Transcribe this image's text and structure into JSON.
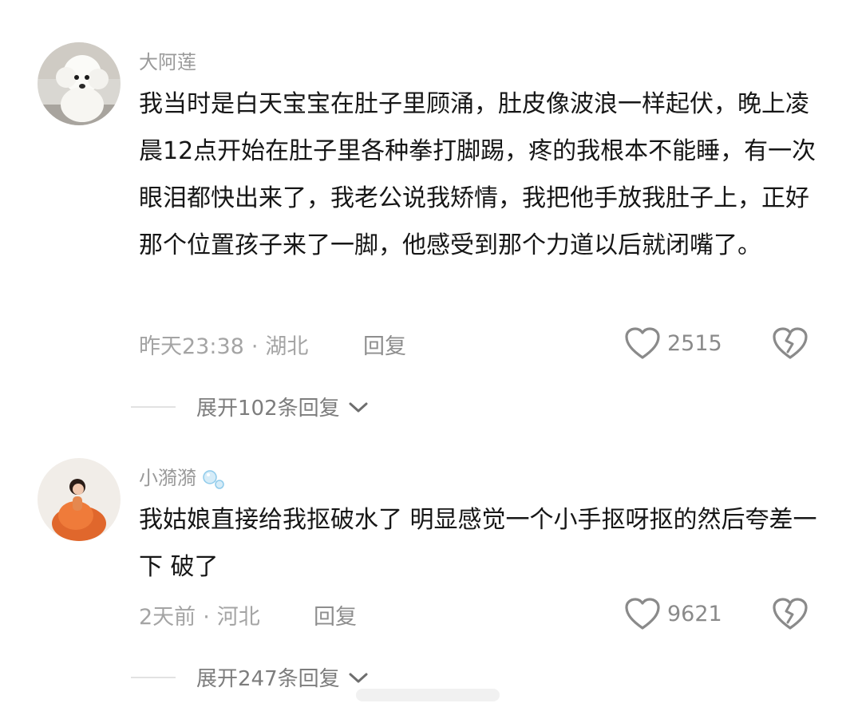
{
  "comments": [
    {
      "username": "大阿莲",
      "text": "我当时是白天宝宝在肚子里顾涌，肚皮像波浪一样起伏，晚上凌晨12点开始在肚子里各种拳打脚踢，疼的我根本不能睡，有一次眼泪都快出来了，我老公说我矫情，我把他手放我肚子上，正好那个位置孩子来了一脚，他感受到那个力道以后就闭嘴了。",
      "time": "昨天23:38",
      "separator": "·",
      "location": "湖北",
      "reply_label": "回复",
      "likes": "2515",
      "expand_label": "展开102条回复",
      "avatar_icon": "white-poodle-avatar"
    },
    {
      "username": "小漪漪",
      "text": "我姑娘直接给我抠破水了 明显感觉一个小手抠呀抠的然后夸差一下 破了",
      "time": "2天前",
      "separator": "·",
      "location": "河北",
      "reply_label": "回复",
      "likes": "9621",
      "expand_label": "展开247条回复",
      "avatar_icon": "woman-orange-dress-avatar"
    }
  ],
  "colors": {
    "text": "#161616",
    "username": "#9a9a9a",
    "meta": "#a4a4a4",
    "icon": "#8a8a8a",
    "divider": "#e2e2e2"
  }
}
